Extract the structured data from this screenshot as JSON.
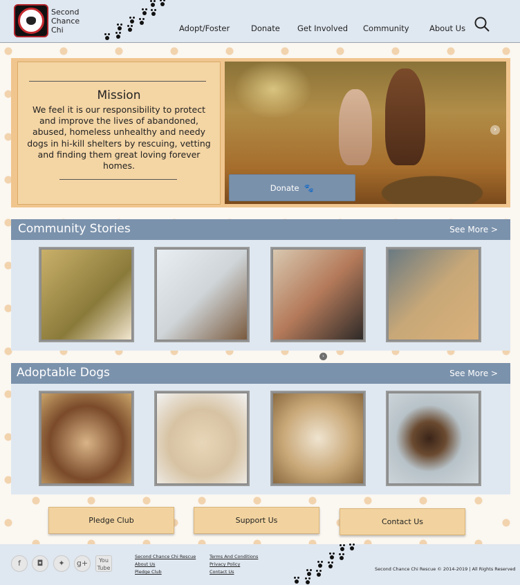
{
  "header": {
    "logo_text": "Second Chance Chi",
    "nav": [
      "Adopt/Foster",
      "Donate",
      "Get Involved",
      "Community",
      "About Us"
    ]
  },
  "hero": {
    "mission_title": "Mission",
    "mission_text": "We feel it is our responsibility to protect and improve the lives of abandoned, abused, homeless unhealthy and needy dogs in hi-kill shelters by rescuing, vetting and finding them great loving forever homes.",
    "donate_label": "Donate"
  },
  "community": {
    "title": "Community Stories",
    "see_more": "See More >"
  },
  "adoptable": {
    "title": "Adoptable Dogs",
    "see_more": "See More >"
  },
  "cta": {
    "pledge": "Pledge Club",
    "support": "Support Us",
    "contact": "Contact Us"
  },
  "footer": {
    "social": [
      "facebook-icon",
      "instagram-icon",
      "twitter-icon",
      "google-plus-icon",
      "youtube-icon"
    ],
    "youtube_text": "You Tube",
    "links_col1": [
      "Second Chance Chi Rescue",
      "About Us",
      "Pledge Club"
    ],
    "links_col2": [
      "Terms And Conditions",
      "Privacy Policy",
      "Contact Us"
    ],
    "copyright": "Second Chance Chi Rescue © 2014-2019 | All Rights Reserved"
  },
  "colors": {
    "header_bg": "#dfe7f0",
    "section_bar": "#7b92ac",
    "mission_bg": "#f4d5a4",
    "cta_bg": "#f2d39f"
  }
}
